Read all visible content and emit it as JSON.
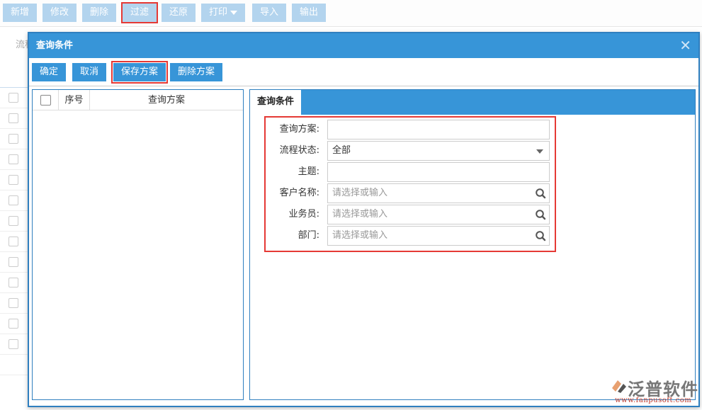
{
  "toolbar": {
    "buttons": [
      {
        "label": "新增"
      },
      {
        "label": "修改"
      },
      {
        "label": "删除"
      },
      {
        "label": "过滤",
        "highlighted": true
      },
      {
        "label": "还原"
      },
      {
        "label": "打印",
        "has_dropdown": true
      },
      {
        "label": "导入"
      },
      {
        "label": "输出"
      }
    ]
  },
  "background": {
    "label_fragment": "流程",
    "row_count": 13
  },
  "dialog": {
    "title": "查询条件",
    "close_icon": "close-icon",
    "actions": {
      "confirm": "确定",
      "cancel": "取消",
      "save_scheme": "保存方案",
      "delete_scheme": "删除方案"
    },
    "scheme_list": {
      "columns": {
        "index": "序号",
        "name": "查询方案"
      },
      "rows": []
    },
    "tab": "查询条件",
    "form": {
      "scheme": {
        "label": "查询方案:",
        "value": ""
      },
      "status": {
        "label": "流程状态:",
        "value": "全部"
      },
      "subject": {
        "label": "主题:",
        "value": ""
      },
      "customer": {
        "label": "客户名称:",
        "placeholder": "请选择或输入"
      },
      "salesperson": {
        "label": "业务员:",
        "placeholder": "请选择或输入"
      },
      "department": {
        "label": "部门:",
        "placeholder": "请选择或输入"
      }
    }
  },
  "watermark": {
    "brand": "泛普软件",
    "url": "www.fanpusoft.com"
  },
  "colors": {
    "primary": "#3795d8",
    "toolbar_button": "#b3d4ee",
    "highlight": "#e53935"
  }
}
